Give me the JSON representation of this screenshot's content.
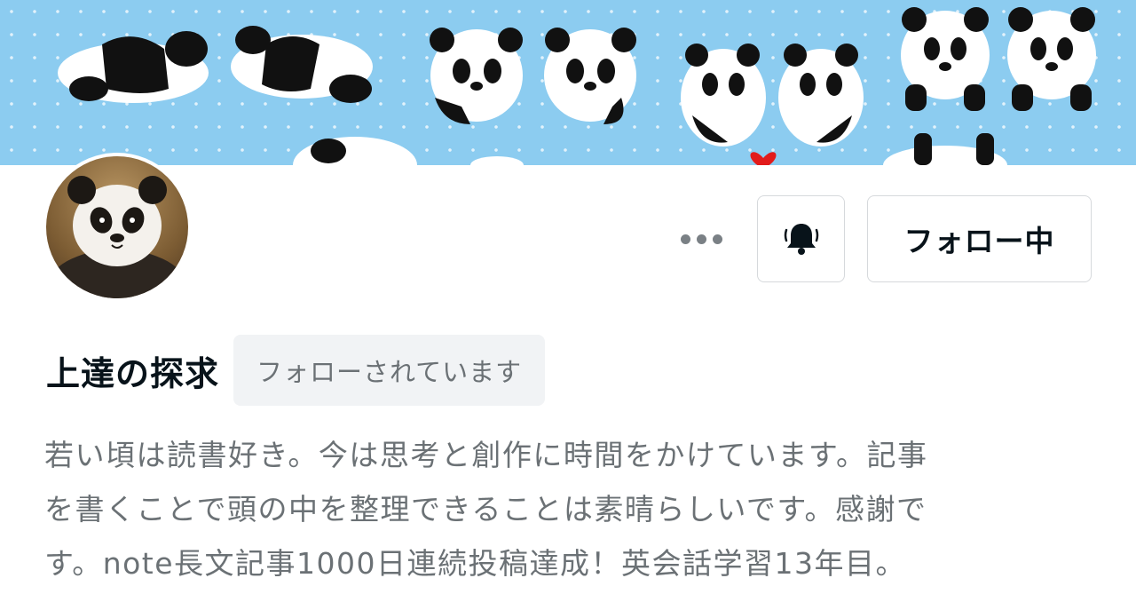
{
  "header": {
    "banner_image": "panda-illustration-banner",
    "banner_bg_color": "#8cccf0"
  },
  "profile": {
    "avatar": "baby-panda-photo",
    "name": "上達の探求",
    "follows_you_badge": "フォローされています",
    "bio": "若い頃は読書好き。今は思考と創作に時間をかけています。記事\nを書くことで頭の中を整理できることは素晴らしいです。感謝で\nす。note長文記事1000日連続投稿達成！英会話学習13年目。"
  },
  "actions": {
    "more_icon": "more-horizontal-icon",
    "bell_icon": "bell-icon",
    "follow_label": "フォロー中"
  }
}
